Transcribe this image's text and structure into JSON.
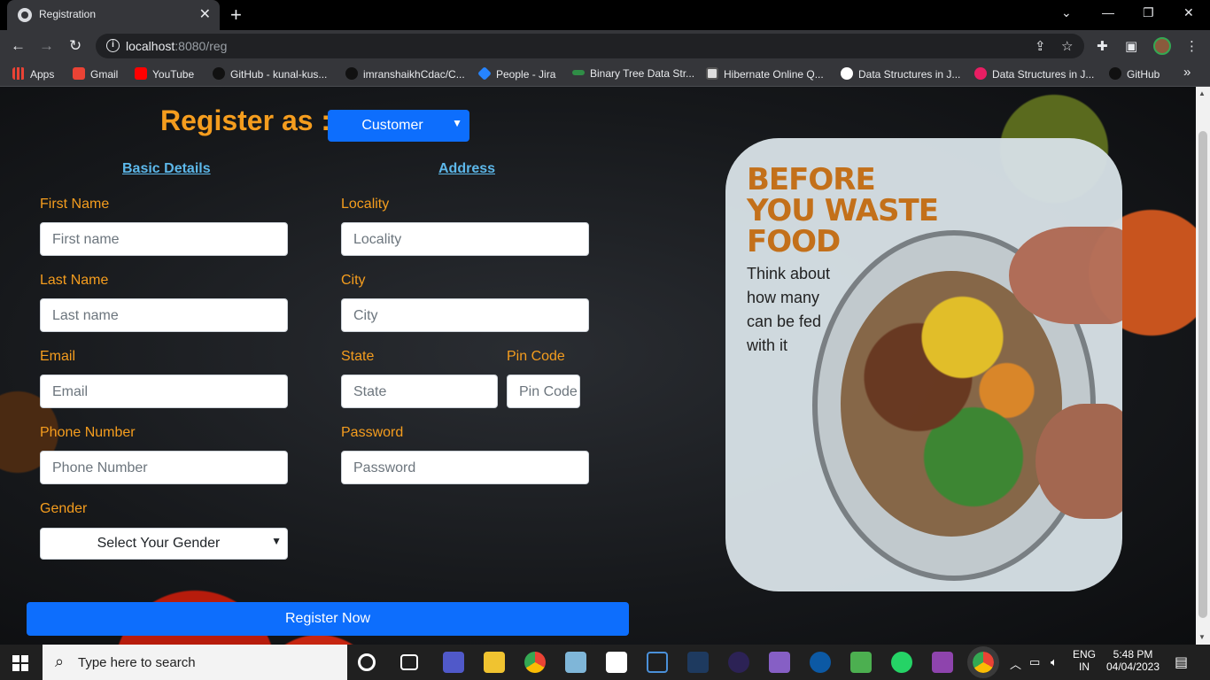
{
  "browser": {
    "tab_title": "Registration",
    "tab_close": "✕",
    "new_tab": "+",
    "url_host": "localhost",
    "url_path": ":8080/reg",
    "window_controls": [
      "⌄",
      "—",
      "❐",
      "✕"
    ],
    "nav": {
      "back": "←",
      "forward": "→",
      "reload": "↻"
    }
  },
  "bookmarks": [
    {
      "label": "Apps",
      "color": "#ea4335"
    },
    {
      "label": "Gmail",
      "color": "#ea4335"
    },
    {
      "label": "YouTube",
      "color": "#ff0000"
    },
    {
      "label": "GitHub - kunal-kus...",
      "color": "#111111"
    },
    {
      "label": "imranshaikhCdac/C...",
      "color": "#111111"
    },
    {
      "label": "People - Jira",
      "color": "#2684ff"
    },
    {
      "label": "Binary Tree Data Str...",
      "color": "#2f8d46"
    },
    {
      "label": "Hibernate Online Q...",
      "color": "#dddddd"
    },
    {
      "label": "Data Structures in J...",
      "color": "#ffffff"
    },
    {
      "label": "Data Structures in J...",
      "color": "#e91e63"
    },
    {
      "label": "GitHub",
      "color": "#111111"
    }
  ],
  "bookmarks_more": "»",
  "form": {
    "title": "Register as :",
    "role_value": "Customer",
    "basic_heading": "Basic Details",
    "address_heading": "Address",
    "first_name_label": "First Name",
    "first_name_placeholder": "First name",
    "last_name_label": "Last Name",
    "last_name_placeholder": "Last name",
    "email_label": "Email",
    "email_placeholder": "Email",
    "phone_label": "Phone Number",
    "phone_placeholder": "Phone Number",
    "gender_label": "Gender",
    "gender_value": "Select Your Gender",
    "locality_label": "Locality",
    "locality_placeholder": "Locality",
    "city_label": "City",
    "city_placeholder": "City",
    "state_label": "State",
    "state_placeholder": "State",
    "pincode_label": "Pin Code",
    "pincode_placeholder": "Pin Code",
    "password_label": "Password",
    "password_placeholder": "Password",
    "submit_label": "Register Now"
  },
  "poster": {
    "headline_1": "BEFORE",
    "headline_2": "YOU WASTE",
    "headline_3": "FOOD",
    "subline": "Think about how many can be fed with it"
  },
  "taskbar": {
    "search_placeholder": "Type here to search",
    "lang_1": "ENG",
    "lang_2": "IN",
    "time": "5:48 PM",
    "date": "04/04/2023",
    "colors": {
      "accent": "#0d6efd",
      "title_orange": "#f59d1e",
      "heading_blue": "#5db8ea"
    }
  }
}
